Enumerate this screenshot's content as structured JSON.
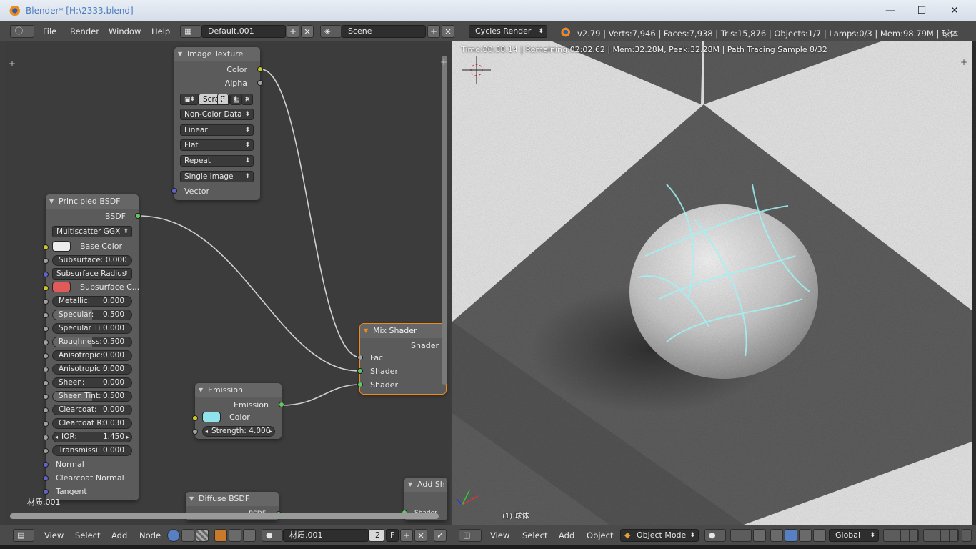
{
  "window": {
    "title": "Blender* [H:\\2333.blend]"
  },
  "menu": {
    "items": [
      "File",
      "Render",
      "Window",
      "Help"
    ]
  },
  "screen_layout": "Default.001",
  "scene": "Scene",
  "render_engine": "Cycles Render",
  "stats": "v2.79 | Verts:7,946 | Faces:7,938 | Tris:15,876 | Objects:1/7 | Lamps:0/3 | Mem:98.79M | 球体",
  "nodes": {
    "image_texture": {
      "title": "Image Texture",
      "out_color": "Color",
      "out_alpha": "Alpha",
      "image_name": "Scrat",
      "image_f": "F",
      "color_space": "Non-Color Data",
      "interpolation": "Linear",
      "projection": "Flat",
      "extension": "Repeat",
      "source": "Single Image",
      "in_vector": "Vector"
    },
    "principled": {
      "title": "Principled BSDF",
      "out_bsdf": "BSDF",
      "distribution": "Multiscatter GGX",
      "base_color_label": "Base Color",
      "base_color": "#ececec",
      "subsurface": {
        "label": "Subsurface:",
        "value": "0.000"
      },
      "subsurface_radius": "Subsurface Radius",
      "subsurface_color_label": "Subsurface C...",
      "subsurface_color": "#e05a5a",
      "metallic": {
        "label": "Metallic:",
        "value": "0.000"
      },
      "specular": {
        "label": "Specular:",
        "value": "0.500"
      },
      "specular_tint": {
        "label": "Specular Ti",
        "value": "0.000"
      },
      "roughness": {
        "label": "Roughness:",
        "value": "0.500"
      },
      "anisotropic": {
        "label": "Anisotropic:",
        "value": "0.000"
      },
      "anisotropic_rot": {
        "label": "Anisotropic :",
        "value": "0.000"
      },
      "sheen": {
        "label": "Sheen:",
        "value": "0.000"
      },
      "sheen_tint": {
        "label": "Sheen Tint:",
        "value": "0.500"
      },
      "clearcoat": {
        "label": "Clearcoat:",
        "value": "0.000"
      },
      "clearcoat_r": {
        "label": "Clearcoat R:",
        "value": "0.030"
      },
      "ior": {
        "label": "IOR:",
        "value": "1.450"
      },
      "transmission": {
        "label": "Transmissi:",
        "value": "0.000"
      },
      "in_normal": "Normal",
      "in_clearcoat_normal": "Clearcoat Normal",
      "in_tangent": "Tangent"
    },
    "mix": {
      "title": "Mix Shader",
      "out_shader": "Shader",
      "in_fac": "Fac",
      "in_shader1": "Shader",
      "in_shader2": "Shader"
    },
    "emission": {
      "title": "Emission",
      "out_emission": "Emission",
      "color_label": "Color",
      "color": "#8fe3ea",
      "strength": "Strength: 4.000"
    },
    "diffuse": {
      "title": "Diffuse BSDF",
      "out_bsdf": "BSDF"
    },
    "add": {
      "title": "Add Sh",
      "out_shader": "Shader"
    }
  },
  "material_name": "材质.001",
  "viewport": {
    "info": "Time:00:38.14 | Remaining:02:02.62 | Mem:32.28M, Peak:32.28M | Path Tracing Sample 8/32",
    "object_label": "(1) 球体"
  },
  "node_header": {
    "view": "View",
    "select": "Select",
    "add": "Add",
    "node": "Node",
    "material": "材质.001",
    "users": "2",
    "fake": "F"
  },
  "view3d_header": {
    "view": "View",
    "select": "Select",
    "add": "Add",
    "object": "Object",
    "mode": "Object Mode",
    "orientation": "Global"
  }
}
